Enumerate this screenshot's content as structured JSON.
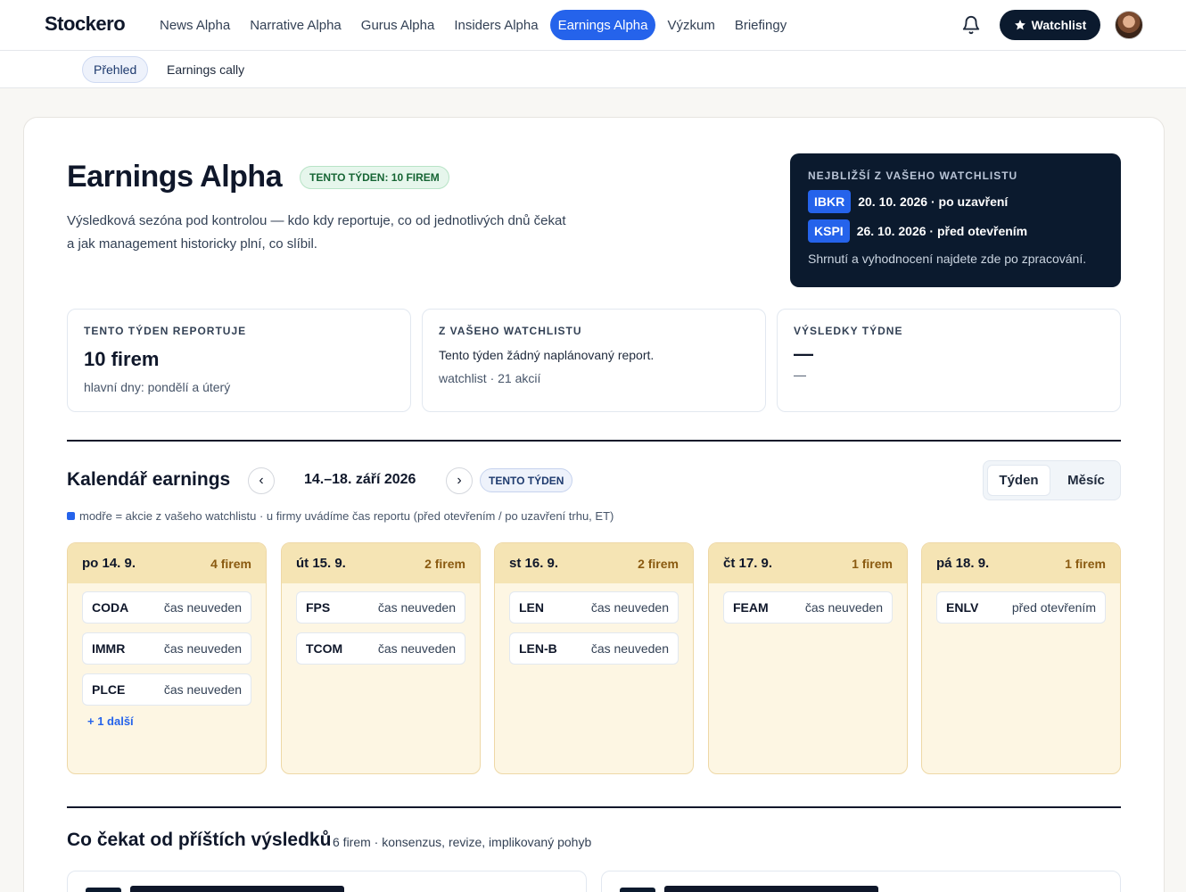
{
  "nav": {
    "logo": "Stockero",
    "links": [
      "News Alpha",
      "Narrative Alpha",
      "Gurus Alpha",
      "Insiders Alpha",
      "Earnings Alpha",
      "Výzkum",
      "Briefingy"
    ],
    "active_index": 4,
    "watchlist_label": "Watchlist"
  },
  "subnav": {
    "tabs": [
      "Přehled",
      "Earnings cally"
    ],
    "active_index": 0
  },
  "hero": {
    "title": "Earnings Alpha",
    "badge": "TENTO TÝDEN: 10 FIREM",
    "subtitle_1": "Výsledková sezóna pod kontrolou — kdo kdy reportuje, co od jednotlivých dnů čekat",
    "subtitle_2": "a jak management historicky plní, co slíbil."
  },
  "next": {
    "title": "NEJBLIŽŠÍ Z VAŠEHO WATCHLISTU",
    "rows": [
      {
        "ticker": "IBKR",
        "text": "20. 10. 2026 · po uzavření"
      },
      {
        "ticker": "KSPI",
        "text": "26. 10. 2026 · před otevřením"
      }
    ],
    "note": "Shrnutí a vyhodnocení najdete zde po zpracování."
  },
  "stats": [
    {
      "label": "TENTO TÝDEN REPORTUJE",
      "big": "10 firem",
      "small": "hlavní dny: pondělí a úterý"
    },
    {
      "label": "Z VAŠEHO WATCHLISTU",
      "text": "Tento týden žádný naplánovaný report.",
      "small": "watchlist · 21 akcií"
    },
    {
      "label": "VÝSLEDKY TÝDNE",
      "big": "—",
      "small": "—"
    }
  ],
  "calendar": {
    "title": "Kalendář earnings",
    "prev": "‹",
    "next": "›",
    "range": "14.–18. září 2026",
    "this_week": "TENTO TÝDEN",
    "views": [
      "Týden",
      "Měsíc"
    ],
    "active_view": 0,
    "legend": "modře = akcie z vašeho watchlistu · u firmy uvádíme čas reportu (před otevřením / po uzavření trhu, ET)",
    "days": [
      {
        "name": "po 14. 9.",
        "count": "4 firem",
        "items": [
          {
            "ticker": "CODA",
            "time": "čas neuveden"
          },
          {
            "ticker": "IMMR",
            "time": "čas neuveden"
          },
          {
            "ticker": "PLCE",
            "time": "čas neuveden"
          }
        ],
        "more": "+ 1 další"
      },
      {
        "name": "út 15. 9.",
        "count": "2 firem",
        "items": [
          {
            "ticker": "FPS",
            "time": "čas neuveden"
          },
          {
            "ticker": "TCOM",
            "time": "čas neuveden"
          }
        ]
      },
      {
        "name": "st 16. 9.",
        "count": "2 firem",
        "items": [
          {
            "ticker": "LEN",
            "time": "čas neuveden"
          },
          {
            "ticker": "LEN-B",
            "time": "čas neuveden"
          }
        ]
      },
      {
        "name": "čt 17. 9.",
        "count": "1 firem",
        "items": [
          {
            "ticker": "FEAM",
            "time": "čas neuveden"
          }
        ]
      },
      {
        "name": "pá 18. 9.",
        "count": "1 firem",
        "items": [
          {
            "ticker": "ENLV",
            "time": "před otevřením"
          }
        ]
      }
    ]
  },
  "next_results": {
    "title": "Co čekat od příštích výsledků",
    "subtitle": "6 firem · konsenzus, revize, implikovaný pohyb"
  },
  "colors": {
    "accent": "#2563eb",
    "dark": "#0b1a2e",
    "day_bg": "#fdf6e3",
    "day_head": "#f5e4b4"
  },
  "icons": {
    "bell": "bell-icon",
    "star": "star-icon",
    "prev": "chevron-left-icon",
    "next": "chevron-right-icon"
  }
}
